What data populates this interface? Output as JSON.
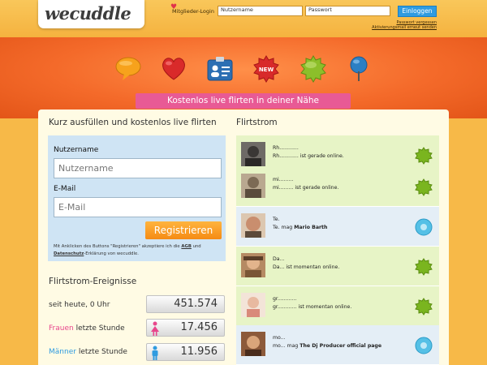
{
  "header": {
    "logo": "wecuddle",
    "login_label": "Mitglieder-Login",
    "username_value": "Nutzername",
    "password_value": "Passwort",
    "login_button": "Einloggen",
    "forgot_password": "Passwort vergessen",
    "resend_activation": "Aktivierungsmail erneut senden"
  },
  "nav_icons": [
    "speech-bubble-icon",
    "heart-icon",
    "id-card-icon",
    "new-badge-icon",
    "green-star-icon",
    "map-pin-icon"
  ],
  "slogan": "Kostenlos live flirten in deiner Nähe",
  "register": {
    "title": "Kurz ausfüllen und kostenlos live flirten",
    "username_label": "Nutzername",
    "username_placeholder": "Nutzername",
    "email_label": "E-Mail",
    "email_placeholder": "E-Mail",
    "button": "Registrieren",
    "note_prefix": "Mit Anklicken des Buttons \"Registrieren\" akzeptiere ich die",
    "note_agb": "AGB",
    "note_and": "und",
    "note_privacy": "Datenschutz",
    "note_suffix": "-Erklärung von wecuddle."
  },
  "stats": {
    "title": "Flirtstrom-Ereignisse",
    "since_today_label": "seit heute, 0 Uhr",
    "since_today_value": "451.574",
    "women_word": "Frauen",
    "women_rest": "letzte Stunde",
    "women_value": "17.456",
    "men_word": "Männer",
    "men_rest": "letzte Stunde",
    "men_value": "11.956"
  },
  "feed": {
    "title": "Flirtstrom",
    "items": [
      {
        "name": "Rh............",
        "prefix": "Rh............",
        "bold": "",
        "suffix": " ist gerade online.",
        "badge": "green"
      },
      {
        "name": "mi.........",
        "prefix": "mi.........",
        "bold": "",
        "suffix": " ist gerade online.",
        "badge": "green"
      },
      {
        "name": "Te.",
        "prefix": "Te. mag ",
        "bold": "Mario Barth",
        "suffix": "",
        "badge": "blue"
      },
      {
        "name": "Da...",
        "prefix": "Da...",
        "bold": "",
        "suffix": " ist momentan online.",
        "badge": "green"
      },
      {
        "name": "gr............",
        "prefix": "gr............",
        "bold": "",
        "suffix": " ist momentan online.",
        "badge": "green"
      },
      {
        "name": "mo...",
        "prefix": "mo... mag ",
        "bold": "The Dj Producer official page",
        "suffix": "",
        "badge": "blue"
      }
    ]
  },
  "colors": {
    "orange_top": "#f7b948",
    "banner": "#f46a2a",
    "pink": "#e85a95",
    "blue_button": "#2f9be0",
    "register_orange": "#f58b14",
    "women": "#e8468c",
    "men": "#2f9be0"
  }
}
